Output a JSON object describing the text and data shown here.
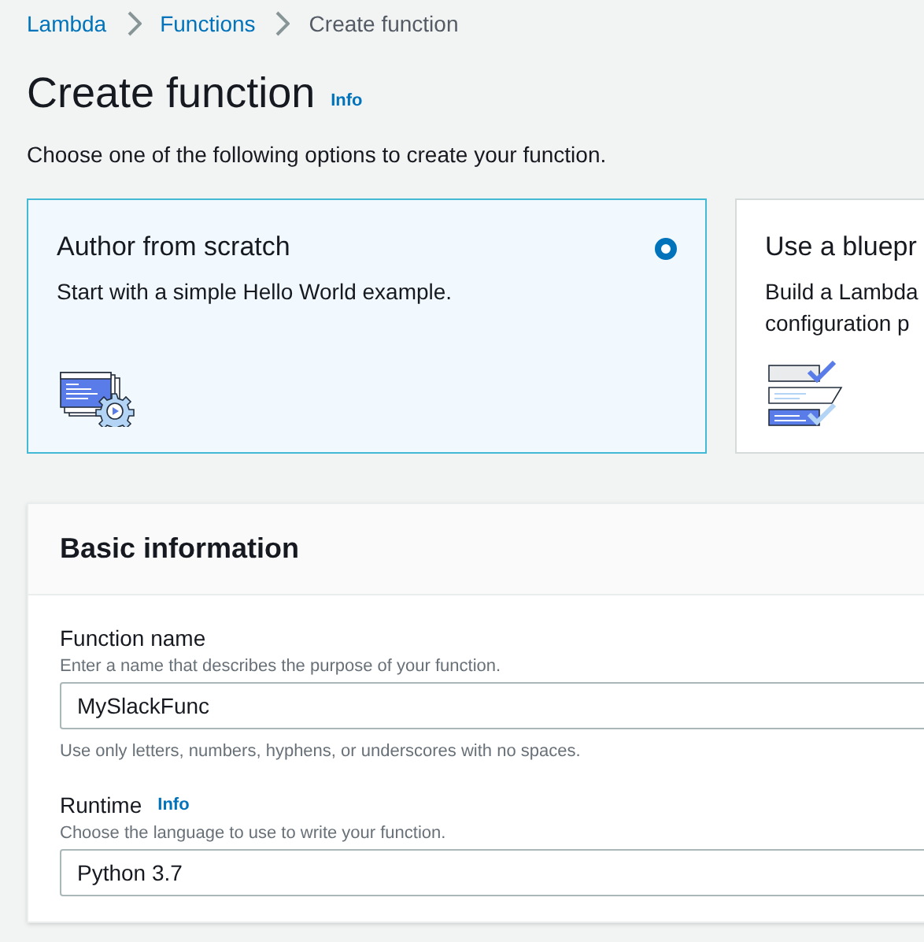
{
  "breadcrumbs": [
    {
      "label": "Lambda",
      "link": true
    },
    {
      "label": "Functions",
      "link": true
    },
    {
      "label": "Create function",
      "link": false
    }
  ],
  "page_title": "Create function",
  "title_info": "Info",
  "intro": "Choose one of the following options to create your function.",
  "options": [
    {
      "kind": "author",
      "title": "Author from scratch",
      "description_lines": [
        "Start with a simple Hello World example."
      ],
      "selected": true
    },
    {
      "kind": "blueprint",
      "title": "Use a bluepr",
      "description_lines": [
        "Build a Lambda",
        "configuration p"
      ],
      "selected": false
    }
  ],
  "panel": {
    "title": "Basic information",
    "fields": [
      {
        "label": "Function name",
        "hint": "Enter a name that describes the purpose of your function.",
        "value": "MySlackFunc",
        "note": "Use only letters, numbers, hyphens, or underscores with no spaces."
      },
      {
        "label": "Runtime",
        "info": "Info",
        "hint": "Choose the language to use to write your function.",
        "value": "Python 3.7"
      }
    ]
  }
}
